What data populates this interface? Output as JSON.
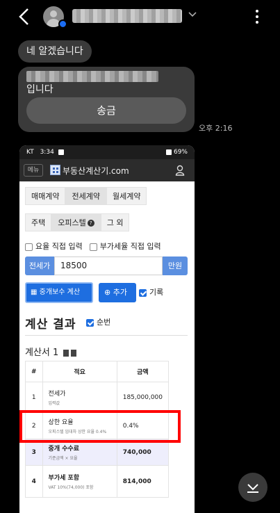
{
  "header": {
    "contact_name": "(hidden)",
    "icons": [
      "back-icon",
      "avatar",
      "chevron-down-icon",
      "more-vert-icon"
    ]
  },
  "messages": [
    {
      "text": "네 알겠습니다"
    },
    {
      "text_line2": "입니다",
      "button": "송금",
      "time": "오후 2:16"
    }
  ],
  "screenshot": {
    "status": {
      "carrier": "KT",
      "time": "3:34",
      "battery": "69%"
    },
    "site": {
      "menu": "메뉴",
      "name": "부동산계산기.com"
    },
    "tabs_row1": [
      "매매계약",
      "전세계약",
      "월세계약"
    ],
    "tabs_row2": [
      "주택",
      "오피스텔",
      "그 외"
    ],
    "options": [
      "요율 직접 입력",
      "부가세율 직접 입력"
    ],
    "input": {
      "prefix": "전세가",
      "value": "18500",
      "suffix": "만원"
    },
    "buttons": {
      "calc": "중개보수 계산",
      "add": "추가",
      "record": "기록"
    },
    "result": {
      "title": "계산 결과",
      "order": "순번",
      "sheet": "계산서 1"
    },
    "table": {
      "headers": [
        "#",
        "적요",
        "금액"
      ],
      "rows": [
        {
          "n": "1",
          "title": "전세가",
          "sub": "입력값",
          "amount": "185,000,000"
        },
        {
          "n": "2",
          "title": "상한 요율",
          "sub": "오피스텔 임대차 상한 요율 0.4%",
          "amount": "0.4%"
        },
        {
          "n": "3",
          "title": "중개 수수료",
          "sub": "기준금액 × 요율",
          "amount": "740,000"
        },
        {
          "n": "4",
          "title": "부가세 포함",
          "sub": "VAT 10%(74,000) 포함",
          "amount": "814,000"
        }
      ]
    }
  },
  "colors": {
    "accent": "#1e6ee0",
    "highlight": "#ff0000"
  }
}
